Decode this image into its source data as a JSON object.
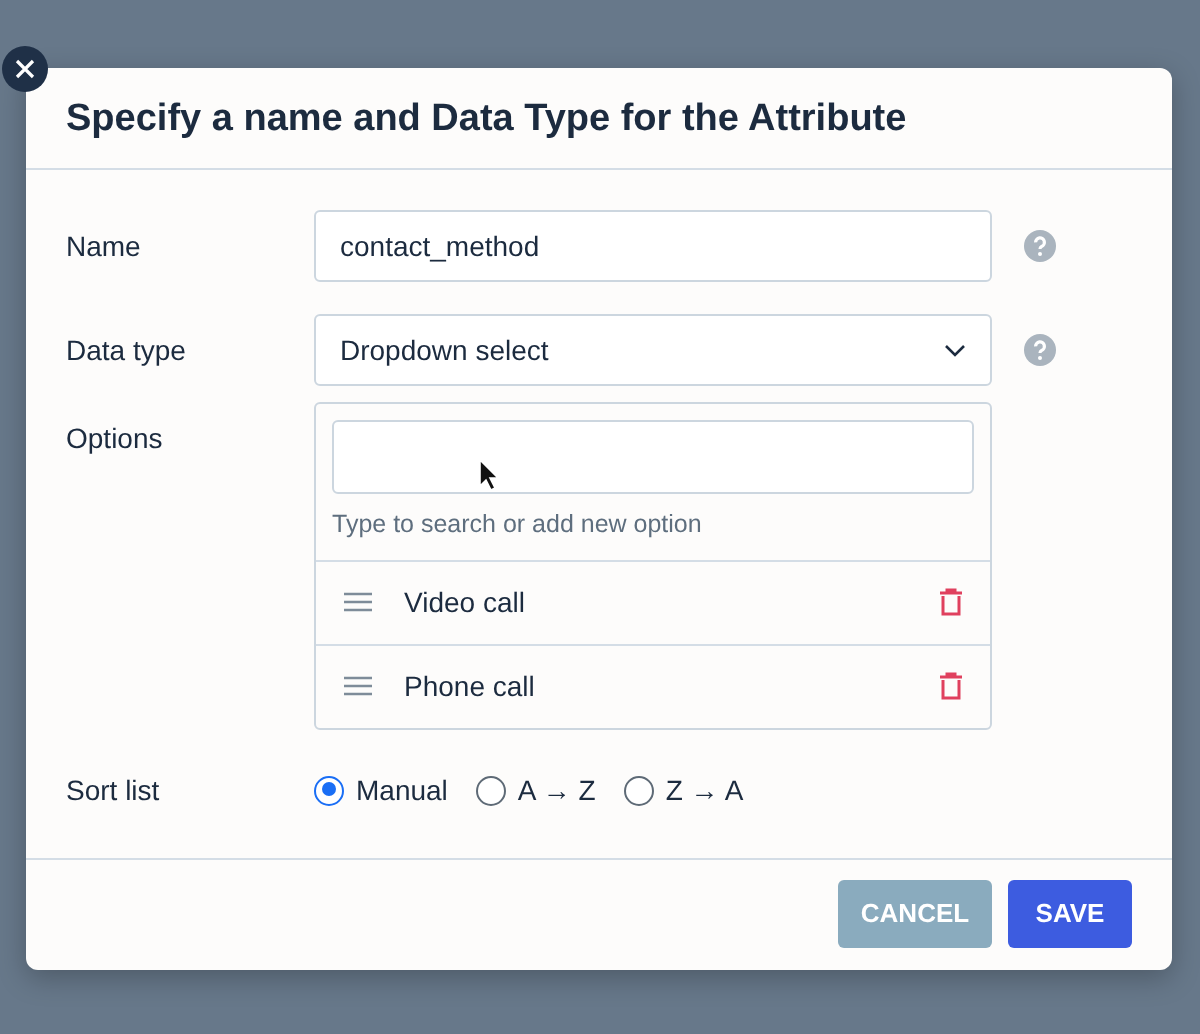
{
  "dialog": {
    "title": "Specify a name and Data Type for the Attribute"
  },
  "name_field": {
    "label": "Name",
    "value": "contact_method"
  },
  "data_type_field": {
    "label": "Data type",
    "value": "Dropdown select"
  },
  "options": {
    "label": "Options",
    "hint": "Type to search or add new option",
    "items": [
      {
        "label": "Video call"
      },
      {
        "label": "Phone call"
      }
    ]
  },
  "sort": {
    "label": "Sort list",
    "choices": [
      {
        "label": "Manual",
        "selected": true
      },
      {
        "label": "A → Z",
        "selected": false
      },
      {
        "label": "Z → A",
        "selected": false
      }
    ]
  },
  "buttons": [
    {
      "label": "CANCEL",
      "kind": "secondary"
    },
    {
      "label": "SAVE",
      "kind": "primary"
    }
  ]
}
